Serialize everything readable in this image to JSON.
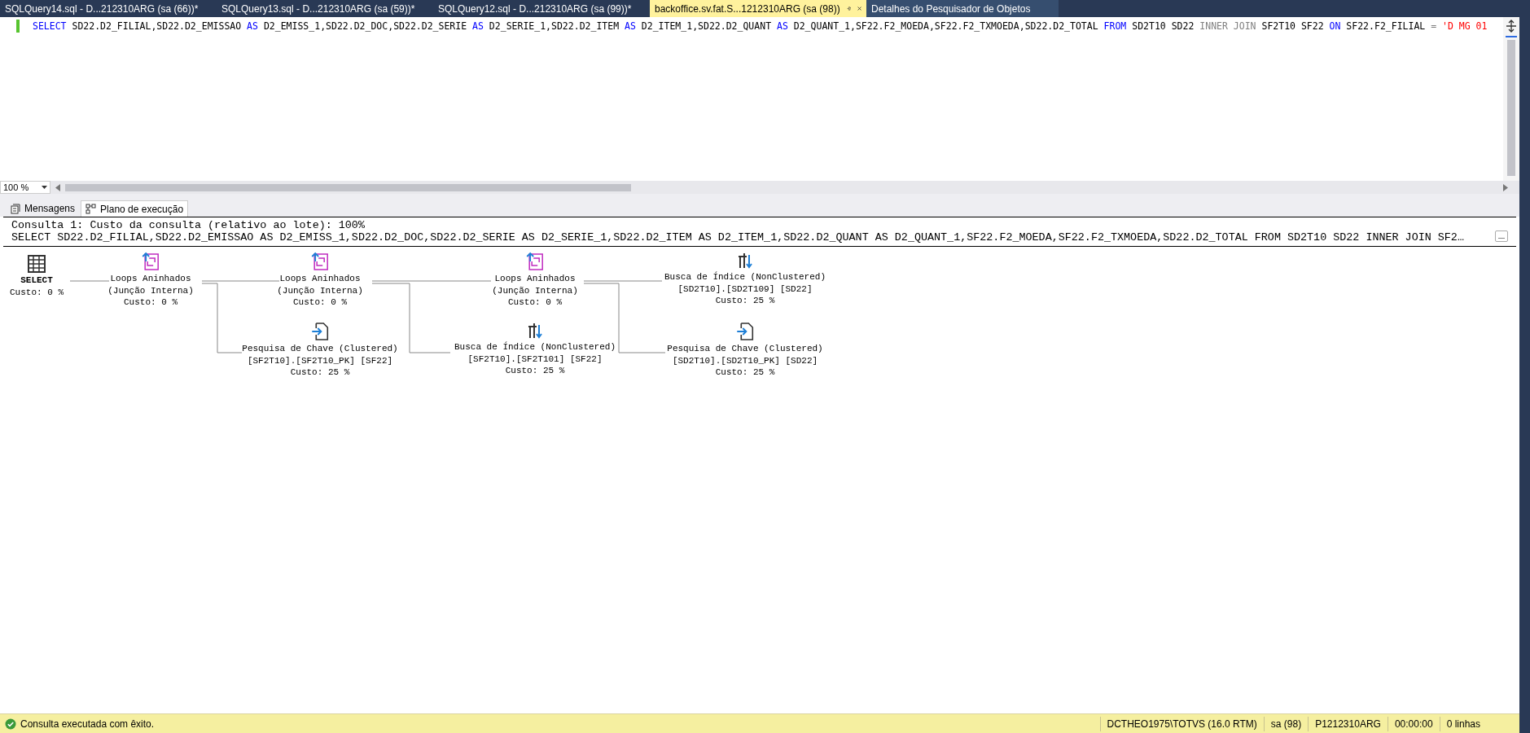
{
  "document_tabs": [
    {
      "label": "SQLQuery14.sql - D...212310ARG (sa (66))*",
      "kind": "document",
      "selected": false
    },
    {
      "label": "SQLQuery13.sql - D...212310ARG (sa (59))*",
      "kind": "document",
      "selected": false
    },
    {
      "label": "SQLQuery12.sql - D...212310ARG (sa (99))*",
      "kind": "document",
      "selected": false
    },
    {
      "label": "backoffice.sv.fat.S...1212310ARG (sa (98))",
      "kind": "document",
      "selected": true
    },
    {
      "label": "Detalhes do Pesquisador de Objetos",
      "kind": "tool",
      "selected": false
    }
  ],
  "sql_editor": {
    "tokens": [
      {
        "text": "SELECT",
        "kind": "keyword"
      },
      {
        "text": " SD22.D2_FILIAL,SD22.D2_EMISSAO ",
        "kind": "plain"
      },
      {
        "text": "AS",
        "kind": "keyword"
      },
      {
        "text": " D2_EMISS_1,SD22.D2_DOC,SD22.D2_SERIE ",
        "kind": "plain"
      },
      {
        "text": "AS",
        "kind": "keyword"
      },
      {
        "text": " D2_SERIE_1,SD22.D2_ITEM ",
        "kind": "plain"
      },
      {
        "text": "AS",
        "kind": "keyword"
      },
      {
        "text": " D2_ITEM_1,SD22.D2_QUANT ",
        "kind": "plain"
      },
      {
        "text": "AS",
        "kind": "keyword"
      },
      {
        "text": " D2_QUANT_1,SF22.F2_MOEDA,SF22.F2_TXMOEDA,SD22.D2_TOTAL ",
        "kind": "plain"
      },
      {
        "text": "FROM",
        "kind": "keyword"
      },
      {
        "text": " SD2T10 SD22 ",
        "kind": "plain"
      },
      {
        "text": "INNER JOIN",
        "kind": "muted"
      },
      {
        "text": " SF2T10 SF22 ",
        "kind": "plain"
      },
      {
        "text": "ON",
        "kind": "keyword"
      },
      {
        "text": " SF22.F2_FILIAL ",
        "kind": "plain"
      },
      {
        "text": "=",
        "kind": "muted"
      },
      {
        "text": " 'D MG 01",
        "kind": "string"
      }
    ]
  },
  "zoom": {
    "value": "100 %"
  },
  "result_tabs": [
    {
      "label": "Mensagens",
      "kind": "messages",
      "selected": false
    },
    {
      "label": "Plano de execução",
      "kind": "plan",
      "selected": true
    }
  ],
  "plan": {
    "header": "Consulta 1: Custo da consulta (relativo ao lote): 100%",
    "query": "SELECT SD22.D2_FILIAL,SD22.D2_EMISSAO AS D2_EMISS_1,SD22.D2_DOC,SD22.D2_SERIE AS D2_SERIE_1,SD22.D2_ITEM AS D2_ITEM_1,SD22.D2_QUANT AS D2_QUANT_1,SF22.F2_MOEDA,SF22.F2_TXMOEDA,SD22.D2_TOTAL FROM SD2T10 SD22 INNER JOIN SF2…",
    "nodes": [
      {
        "kind": "select",
        "title": "SELECT",
        "cost": "Custo: 0 %"
      },
      {
        "kind": "loops",
        "title": "Loops Aninhados",
        "detail": "(Junção Interna)",
        "cost": "Custo: 0 %"
      },
      {
        "kind": "loops",
        "title": "Loops Aninhados",
        "detail": "(Junção Interna)",
        "cost": "Custo: 0 %"
      },
      {
        "kind": "loops",
        "title": "Loops Aninhados",
        "detail": "(Junção Interna)",
        "cost": "Custo: 0 %"
      },
      {
        "kind": "seek",
        "title": "Busca de Índice (NonClustered)",
        "detail": "[SD2T10].[SD2T109] [SD22]",
        "cost": "Custo: 25 %"
      },
      {
        "kind": "lookup",
        "title": "Pesquisa de Chave (Clustered)",
        "detail": "[SF2T10].[SF2T10_PK] [SF22]",
        "cost": "Custo: 25 %"
      },
      {
        "kind": "seek",
        "title": "Busca de Índice (NonClustered)",
        "detail": "[SF2T10].[SF2T101] [SF22]",
        "cost": "Custo: 25 %"
      },
      {
        "kind": "lookup",
        "title": "Pesquisa de Chave (Clustered)",
        "detail": "[SD2T10].[SD2T10_PK] [SD22]",
        "cost": "Custo: 25 %"
      }
    ]
  },
  "status_bar": {
    "message": "Consulta executada com êxito.",
    "items": [
      "DCTHEO1975\\TOTVS (16.0 RTM)",
      "sa (98)",
      "P1212310ARG",
      "00:00:00",
      "0 linhas"
    ]
  }
}
